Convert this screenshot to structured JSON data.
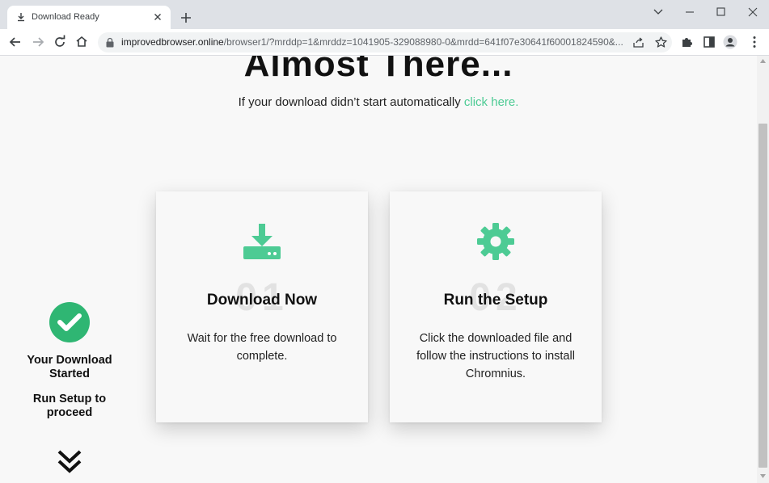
{
  "browser": {
    "tab_title": "Download Ready",
    "url_host": "improvedbrowser.online",
    "url_path": "/browser1/?mrddp=1&mrddz=1041905-329088980-0&mrdd=641f07e30641f60001824590&..."
  },
  "page": {
    "headline": "Almost There...",
    "subline_text": "If your download didn’t start automatically ",
    "subline_link": "click here.",
    "accent_color": "#4dcb94",
    "cards": [
      {
        "number": "01",
        "title": "Download Now",
        "description": "Wait for the free download to complete.",
        "icon": "download-icon"
      },
      {
        "number": "02",
        "title": "Run the Setup",
        "description": "Click the downloaded file and follow the instructions to install Chromnius.",
        "icon": "gear-icon"
      }
    ],
    "side": {
      "status_line_1": "Your Download Started",
      "status_line_2": "Run Setup to proceed",
      "icon": "check-circle-icon"
    }
  }
}
